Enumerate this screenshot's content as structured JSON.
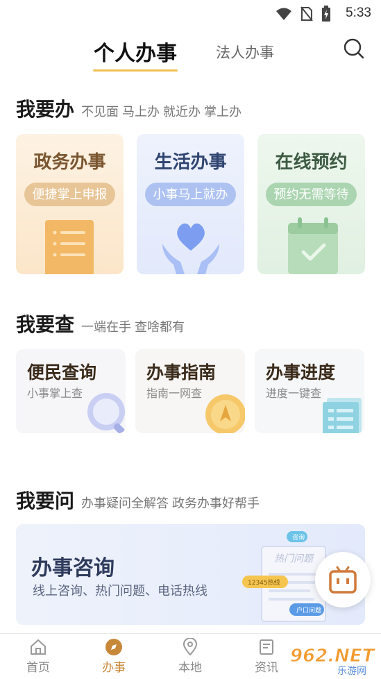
{
  "status_bar": {
    "time": "5:33"
  },
  "top_tabs": {
    "personal": "个人办事",
    "legal": "法人办事"
  },
  "sections": {
    "do": {
      "title": "我要办",
      "subtitle": "不见面 马上办 就近办 掌上办"
    },
    "check": {
      "title": "我要查",
      "subtitle": "一端在手 查啥都有"
    },
    "ask": {
      "title": "我要问",
      "subtitle": "办事疑问全解答 政务办事好帮手"
    }
  },
  "do_cards": [
    {
      "title": "政务办事",
      "tag": "便捷掌上申报",
      "title_color": "#7a5530",
      "pill_color": "#e8bf8a"
    },
    {
      "title": "生活办事",
      "tag": "小事马上就办",
      "title_color": "#2f4470",
      "pill_color": "#a8bdf0"
    },
    {
      "title": "在线预约",
      "tag": "预约无需等待",
      "title_color": "#3d5a43",
      "pill_color": "#a7d2ad"
    }
  ],
  "check_cards": [
    {
      "title": "便民查询",
      "sub": "小事掌上查"
    },
    {
      "title": "办事指南",
      "sub": "指南一网查"
    },
    {
      "title": "办事进度",
      "sub": "进度一键查"
    }
  ],
  "consult": {
    "title": "办事咨询",
    "sub": "线上咨询、热门问题、电话热线",
    "paper_title": "热门问题",
    "bubble1": "咨询",
    "bubble2": "12345热线",
    "bubble3": "户口问题"
  },
  "bottom_nav": [
    {
      "label": "首页"
    },
    {
      "label": "办事"
    },
    {
      "label": "本地"
    },
    {
      "label": "资讯"
    }
  ],
  "watermark": {
    "brand": "962.NET",
    "sub": "乐游网"
  },
  "colors": {
    "accent": "#f2c04f",
    "active_nav": "#c8883a"
  }
}
